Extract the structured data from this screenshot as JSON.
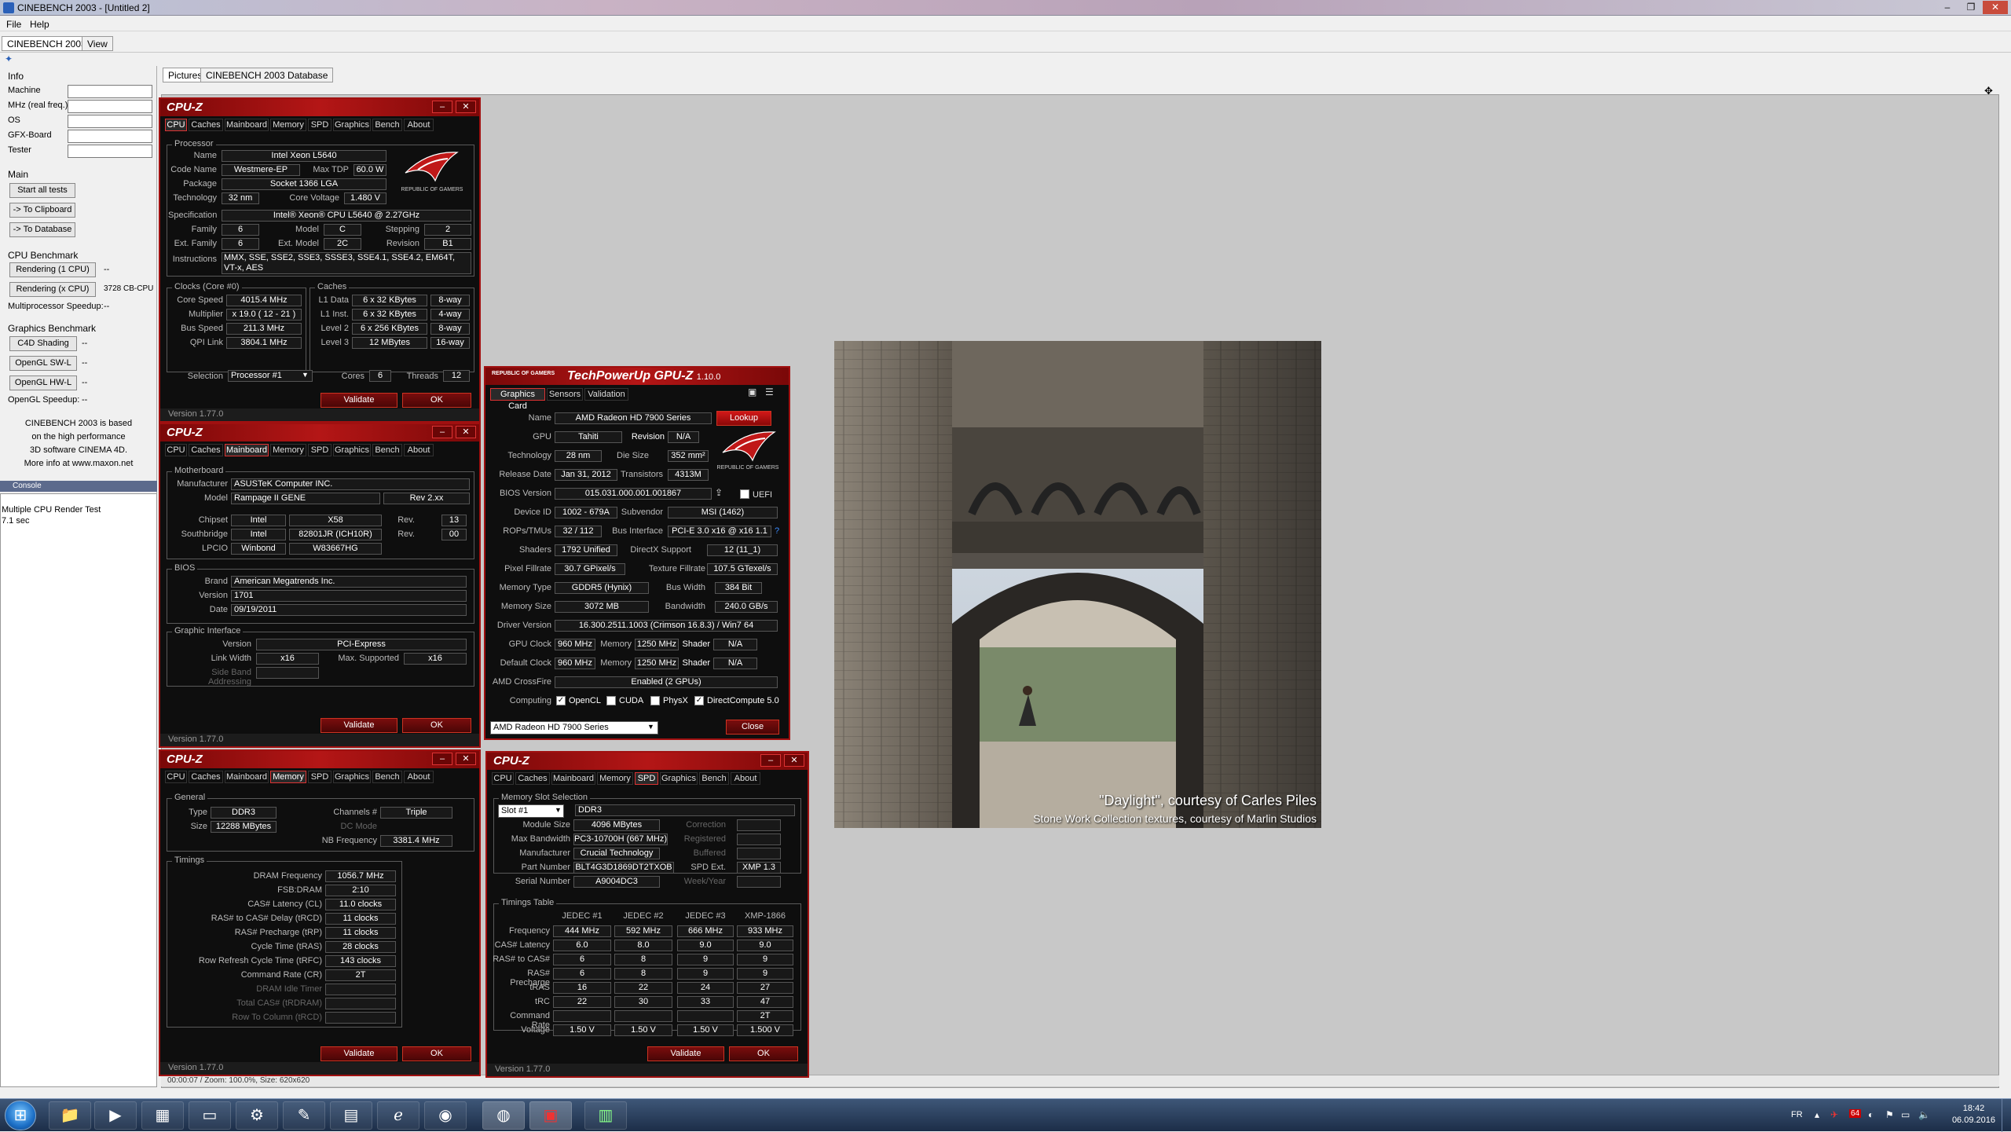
{
  "window": {
    "title": "CINEBENCH 2003 - [Untitled 2]",
    "min": "–",
    "max": "❐",
    "close": "✕"
  },
  "menu": [
    "File",
    "Help"
  ],
  "tabs": [
    "CINEBENCH 2003",
    "View"
  ],
  "left": {
    "info_title": "Info",
    "fields": [
      "Machine",
      "MHz (real freq.)",
      "OS",
      "GFX-Board",
      "Tester"
    ],
    "main_title": "Main",
    "start_all": "Start all tests",
    "to_clipboard": "-> To Clipboard",
    "to_database": "-> To Database",
    "cpu_title": "CPU Benchmark",
    "r1": "Rendering (1 CPU)",
    "r1_val": "--",
    "rx": "Rendering (x CPU)",
    "rx_val": "3728 CB-CPU",
    "mp": "Multiprocessor Speedup:",
    "mp_val": "--",
    "gfx_title": "Graphics Benchmark",
    "c4d": "C4D Shading",
    "c4d_val": "--",
    "swl": "OpenGL SW-L",
    "swl_val": "--",
    "hwl": "OpenGL HW-L",
    "hwl_val": "--",
    "ogl": "OpenGL Speedup:",
    "ogl_val": "--",
    "about": [
      "CINEBENCH 2003 is based",
      "on the high performance",
      "3D software CINEMA 4D.",
      "More info at www.maxon.net"
    ],
    "console_title": "Console",
    "console": [
      "Multiple CPU Render Test",
      "7.1 sec"
    ]
  },
  "content_tabs": [
    "Pictures",
    "CINEBENCH 2003 Database"
  ],
  "statusbar": "00:00:07 / Zoom: 100.0%, Size: 620x620",
  "render": {
    "caption1": "\"Daylight\", courtesy of Carles Piles",
    "caption2": "Stone Work Collection textures, courtesy of Marlin Studios"
  },
  "cpuz_tabs": [
    "CPU",
    "Caches",
    "Mainboard",
    "Memory",
    "SPD",
    "Graphics",
    "Bench",
    "About"
  ],
  "cpuz_common": {
    "title": "CPU-Z",
    "validate": "Validate",
    "ok": "OK",
    "version": "Version 1.77.0",
    "rog": "REPUBLIC OF GAMERS"
  },
  "cpu": {
    "processor": "Processor",
    "name_l": "Name",
    "name": "Intel Xeon L5640",
    "codename_l": "Code Name",
    "codename": "Westmere-EP",
    "maxtdp_l": "Max TDP",
    "maxtdp": "60.0 W",
    "package_l": "Package",
    "package": "Socket 1366 LGA",
    "tech_l": "Technology",
    "tech": "32 nm",
    "cv_l": "Core Voltage",
    "cv": "1.480 V",
    "spec_l": "Specification",
    "spec": "Intel® Xeon® CPU       L5640  @ 2.27GHz",
    "family_l": "Family",
    "family": "6",
    "model_l": "Model",
    "model": "C",
    "stepping_l": "Stepping",
    "stepping": "2",
    "extfam_l": "Ext. Family",
    "extfam": "6",
    "extmod_l": "Ext. Model",
    "extmod": "2C",
    "rev_l": "Revision",
    "rev": "B1",
    "instr_l": "Instructions",
    "instr": "MMX, SSE, SSE2, SSE3, SSSE3, SSE4.1, SSE4.2, EM64T, VT-x, AES",
    "clocks": "Clocks (Core #0)",
    "cs_l": "Core Speed",
    "cs": "4015.4 MHz",
    "mult_l": "Multiplier",
    "mult": "x 19.0 ( 12 - 21 )",
    "bus_l": "Bus Speed",
    "bus": "211.3 MHz",
    "qpi_l": "QPI Link",
    "qpi": "3804.1 MHz",
    "caches": "Caches",
    "l1d_l": "L1 Data",
    "l1d": "6 x 32 KBytes",
    "l1d_w": "8-way",
    "l1i_l": "L1 Inst.",
    "l1i": "6 x 32 KBytes",
    "l1i_w": "4-way",
    "l2_l": "Level 2",
    "l2": "6 x 256 KBytes",
    "l2_w": "8-way",
    "l3_l": "Level 3",
    "l3": "12 MBytes",
    "l3_w": "16-way",
    "sel_l": "Selection",
    "sel": "Processor #1",
    "cores_l": "Cores",
    "cores": "6",
    "threads_l": "Threads",
    "threads": "12"
  },
  "mb": {
    "motherboard": "Motherboard",
    "man_l": "Manufacturer",
    "man": "ASUSTeK Computer INC.",
    "model_l": "Model",
    "model": "Rampage II GENE",
    "model_rev": "Rev 2.xx",
    "chipset_l": "Chipset",
    "chipset_v": "Intel",
    "chipset": "X58",
    "rev_l": "Rev.",
    "chipset_rev": "13",
    "sb_l": "Southbridge",
    "sb_v": "Intel",
    "sb": "82801JR (ICH10R)",
    "sb_rev": "00",
    "lpc_l": "LPCIO",
    "lpc_v": "Winbond",
    "lpc": "W83667HG",
    "bios": "BIOS",
    "brand_l": "Brand",
    "brand": "American Megatrends Inc.",
    "ver_l": "Version",
    "ver": "1701",
    "date_l": "Date",
    "date": "09/19/2011",
    "gi": "Graphic Interface",
    "giv_l": "Version",
    "giv": "PCI-Express",
    "lw_l": "Link Width",
    "lw": "x16",
    "ms_l": "Max. Supported",
    "ms": "x16",
    "sba_l": "Side Band Addressing"
  },
  "mem": {
    "general": "General",
    "type_l": "Type",
    "type": "DDR3",
    "ch_l": "Channels #",
    "ch": "Triple",
    "size_l": "Size",
    "size": "12288 MBytes",
    "dc_l": "DC Mode",
    "nb_l": "NB Frequency",
    "nb": "3381.4 MHz",
    "timings": "Timings",
    "rows": [
      [
        "DRAM Frequency",
        "1056.7 MHz"
      ],
      [
        "FSB:DRAM",
        "2:10"
      ],
      [
        "CAS# Latency (CL)",
        "11.0 clocks"
      ],
      [
        "RAS# to CAS# Delay (tRCD)",
        "11 clocks"
      ],
      [
        "RAS# Precharge (tRP)",
        "11 clocks"
      ],
      [
        "Cycle Time (tRAS)",
        "28 clocks"
      ],
      [
        "Row Refresh Cycle Time (tRFC)",
        "143 clocks"
      ],
      [
        "Command Rate (CR)",
        "2T"
      ],
      [
        "DRAM Idle Timer",
        ""
      ],
      [
        "Total CAS# (tRDRAM)",
        ""
      ],
      [
        "Row To Column (tRCD)",
        ""
      ]
    ]
  },
  "spd": {
    "mss": "Memory Slot Selection",
    "slot": "Slot #1",
    "slot_type": "DDR3",
    "ms_l": "Module Size",
    "ms": "4096 MBytes",
    "corr_l": "Correction",
    "mb_l": "Max Bandwidth",
    "mb": "PC3-10700H (667 MHz)",
    "reg_l": "Registered",
    "man_l": "Manufacturer",
    "man": "Crucial Technology",
    "buf_l": "Buffered",
    "pn_l": "Part Number",
    "pn": "BLT4G3D1869DT2TXOB",
    "spde_l": "SPD Ext.",
    "spde": "XMP 1.3",
    "sn_l": "Serial Number",
    "sn": "A9004DC3",
    "wy_l": "Week/Year",
    "tt": "Timings Table",
    "cols": [
      "JEDEC #1",
      "JEDEC #2",
      "JEDEC #3",
      "XMP-1866"
    ],
    "rows": [
      [
        "Frequency",
        "444 MHz",
        "592 MHz",
        "666 MHz",
        "933 MHz"
      ],
      [
        "CAS# Latency",
        "6.0",
        "8.0",
        "9.0",
        "9.0"
      ],
      [
        "RAS# to CAS#",
        "6",
        "8",
        "9",
        "9"
      ],
      [
        "RAS# Precharge",
        "6",
        "8",
        "9",
        "9"
      ],
      [
        "tRAS",
        "16",
        "22",
        "24",
        "27"
      ],
      [
        "tRC",
        "22",
        "30",
        "33",
        "47"
      ],
      [
        "Command Rate",
        "",
        "",
        "",
        "2T"
      ],
      [
        "Voltage",
        "1.50 V",
        "1.50 V",
        "1.50 V",
        "1.500 V"
      ]
    ]
  },
  "gpuz": {
    "title": "TechPowerUp GPU-Z",
    "version": "1.10.0",
    "tabs": [
      "Graphics Card",
      "Sensors",
      "Validation"
    ],
    "name_l": "Name",
    "name": "AMD Radeon HD 7900 Series",
    "lookup": "Lookup",
    "gpu_l": "GPU",
    "gpu": "Tahiti",
    "revl": "Revision",
    "revv": "N/A",
    "tech_l": "Technology",
    "tech": "28 nm",
    "die_l": "Die Size",
    "die": "352 mm²",
    "rel_l": "Release Date",
    "rel": "Jan 31, 2012",
    "tr_l": "Transistors",
    "tr": "4313M",
    "bios_l": "BIOS Version",
    "bios": "015.031.000.001.001867",
    "uefi": "UEFI",
    "dev_l": "Device ID",
    "dev": "1002 - 679A",
    "sub_l": "Subvendor",
    "sub": "MSI (1462)",
    "rops_l": "ROPs/TMUs",
    "rops": "32 / 112",
    "bi_l": "Bus Interface",
    "bi": "PCI-E 3.0 x16 @ x16 1.1",
    "sh_l": "Shaders",
    "sh": "1792 Unified",
    "dx_l": "DirectX Support",
    "dx": "12 (11_1)",
    "pf_l": "Pixel Fillrate",
    "pf": "30.7 GPixel/s",
    "tf_l": "Texture Fillrate",
    "tf": "107.5 GTexel/s",
    "mt_l": "Memory Type",
    "mt": "GDDR5 (Hynix)",
    "bw_l": "Bus Width",
    "bw": "384 Bit",
    "msz_l": "Memory Size",
    "msz": "3072 MB",
    "band_l": "Bandwidth",
    "band": "240.0 GB/s",
    "drv_l": "Driver Version",
    "drv": "16.300.2511.1003 (Crimson 16.8.3) / Win7 64",
    "gc_l": "GPU Clock",
    "gc": "960 MHz",
    "mem_l": "Memory",
    "gcm": "1250 MHz",
    "shd_l": "Shader",
    "gcs": "N/A",
    "dc_l": "Default Clock",
    "dc": "960 MHz",
    "dcm": "1250 MHz",
    "dcs": "N/A",
    "cf_l": "AMD CrossFire",
    "cf": "Enabled (2 GPUs)",
    "comp_l": "Computing",
    "opencl": "OpenCL",
    "cuda": "CUDA",
    "physx": "PhysX",
    "dcomp": "DirectCompute 5.0",
    "select": "AMD Radeon HD 7900 Series",
    "close": "Close"
  },
  "taskbar": {
    "lang": "FR",
    "time": "18:42",
    "date": "06.09.2016",
    "badge": "64"
  }
}
